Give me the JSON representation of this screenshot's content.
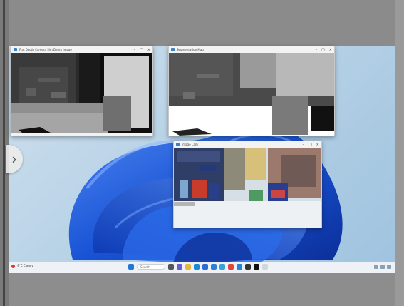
{
  "windows": {
    "depth_left": {
      "title": "Flat Depth Camera Sim Depth Image"
    },
    "depth_right": {
      "title": "Segmentation Map"
    },
    "camera": {
      "title": "Image Cam"
    }
  },
  "taskbar": {
    "search_placeholder": "Search",
    "weather_temp": "9°C",
    "weather_text": "Cloudy",
    "icons": [
      "start-icon",
      "search-box",
      "task-view-icon",
      "chat-icon",
      "file-explorer-icon",
      "edge-icon",
      "store-icon",
      "mail-icon",
      "photos-icon",
      "chrome-icon",
      "vs-code-icon",
      "terminal-icon",
      "unreal-icon",
      "notepad-icon"
    ]
  },
  "colors": {
    "accent": "#1e5bd8",
    "taskbar_bg": "#eef2f6",
    "desktop_bg": "#b7d2e6"
  }
}
